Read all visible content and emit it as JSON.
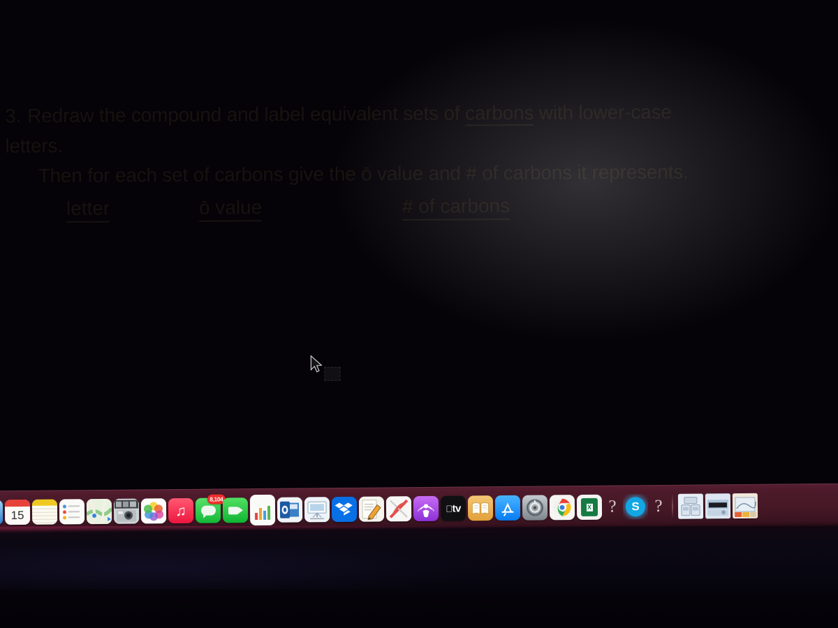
{
  "document": {
    "question_number": "3.",
    "line1": "Redraw the compound and label equivalent sets of ",
    "line1_underlined": "carbons",
    "line1_tail": " with lower-case",
    "line2": "letters.",
    "line3": "Then for each set of carbons give the ō value and # of carbons it represents.",
    "columns": [
      {
        "label": "letter"
      },
      {
        "label": "ō value"
      },
      {
        "label": "# of carbons"
      }
    ]
  },
  "cursor": {
    "type": "arrow-pointer",
    "marquee": "dashed-selection-box"
  },
  "dock": {
    "background_color": "#46182e",
    "items": [
      {
        "name": "finder",
        "label": "",
        "icon": "finder-icon",
        "bg": "#3c7fd4"
      },
      {
        "name": "calendar",
        "label": "15",
        "icon": "calendar-icon",
        "bg": "#f4f3ef"
      },
      {
        "name": "notes",
        "label": "",
        "icon": "notes-icon",
        "bg": "#fdf8e4"
      },
      {
        "name": "reminders",
        "label": "",
        "icon": "reminders-icon",
        "bg": "#f7f7f5"
      },
      {
        "name": "maps",
        "label": "",
        "icon": "maps-icon",
        "bg": "#eef3e7"
      },
      {
        "name": "photo-booth",
        "label": "",
        "icon": "photo-booth-icon",
        "bg": "#b7bcc0"
      },
      {
        "name": "photos",
        "label": "",
        "icon": "photos-icon",
        "bg": "#fbfbfb"
      },
      {
        "name": "music",
        "label": "",
        "icon": "music-icon",
        "bg": "#e8395c"
      },
      {
        "name": "messages",
        "label": "",
        "icon": "messages-icon",
        "bg": "#35c75a",
        "badge": "8,104"
      },
      {
        "name": "facetime",
        "label": "",
        "icon": "facetime-icon",
        "bg": "#2fc44c"
      },
      {
        "name": "numbers",
        "label": "",
        "icon": "numbers-icon",
        "bg": "#f6f6f4"
      },
      {
        "name": "outlook",
        "label": "",
        "icon": "outlook-icon",
        "bg": "#eef2f5"
      },
      {
        "name": "keynote",
        "label": "",
        "icon": "keynote-icon",
        "bg": "#eef3f7"
      },
      {
        "name": "dropbox",
        "label": "",
        "icon": "dropbox-icon",
        "bg": "#0f72e5"
      },
      {
        "name": "pages",
        "label": "",
        "icon": "pages-icon",
        "bg": "#f4f2ec"
      },
      {
        "name": "dvd-player",
        "label": "",
        "icon": "dvd-player-icon",
        "bg": "#f3f2f0"
      },
      {
        "name": "podcasts",
        "label": "",
        "icon": "podcasts-icon",
        "bg": "#9b45d6"
      },
      {
        "name": "apple-tv",
        "label": "tv",
        "icon": "apple-tv-icon",
        "bg": "#121214"
      },
      {
        "name": "books",
        "label": "",
        "icon": "books-icon",
        "bg": "#eab45a"
      },
      {
        "name": "app-store",
        "label": "",
        "icon": "app-store-icon",
        "bg": "#1f8ff5"
      },
      {
        "name": "system-preferences",
        "label": "",
        "icon": "system-preferences-icon",
        "bg": "#9aa0a4"
      },
      {
        "name": "google-chrome",
        "label": "",
        "icon": "chrome-icon",
        "bg": "#f3f3f1"
      },
      {
        "name": "microsoft-excel",
        "label": "X",
        "icon": "excel-icon",
        "bg": "#f2f2f0"
      },
      {
        "name": "unknown-app-1",
        "label": "?",
        "icon": "question-mark-icon",
        "bg": ""
      },
      {
        "name": "skype",
        "label": "S",
        "icon": "skype-icon",
        "bg": "#3d1a2a"
      },
      {
        "name": "unknown-app-2",
        "label": "?",
        "icon": "question-mark-icon",
        "bg": ""
      },
      {
        "name": "downloads-stack",
        "label": "",
        "icon": "downloads-stack-icon",
        "bg": "#e8edf2"
      },
      {
        "name": "document-stack",
        "label": "",
        "icon": "document-stack-icon",
        "bg": "#dce5ee"
      },
      {
        "name": "desktop-stack",
        "label": "",
        "icon": "desktop-stack-icon",
        "bg": "#efe6d8"
      }
    ]
  }
}
